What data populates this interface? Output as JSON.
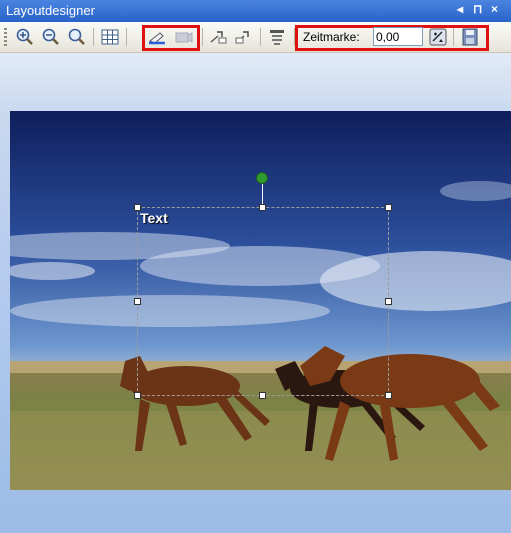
{
  "window": {
    "title": "Layoutdesigner",
    "controls": [
      "◂",
      "⊓",
      "×"
    ]
  },
  "toolbar": {
    "tools": [
      {
        "name": "zoom-in",
        "icon": "zoom-in-icon"
      },
      {
        "name": "zoom-out",
        "icon": "zoom-out-icon"
      },
      {
        "name": "zoom-fit",
        "icon": "zoom-fit-icon"
      },
      {
        "name": "grid",
        "icon": "grid-icon"
      },
      {
        "name": "text",
        "icon": "text-tool-icon"
      },
      {
        "name": "camera",
        "icon": "camera-icon"
      },
      {
        "name": "move-up",
        "icon": "move-up-icon"
      },
      {
        "name": "move-down",
        "icon": "move-down-icon"
      },
      {
        "name": "align",
        "icon": "align-icon"
      },
      {
        "name": "keyframe",
        "icon": "keyframe-icon"
      },
      {
        "name": "save",
        "icon": "save-icon"
      }
    ],
    "zeitmarke_label": "Zeitmarke:",
    "zeitmarke_value": "0,00"
  },
  "canvas": {
    "text_object": "Text"
  },
  "colors": {
    "titlebar": "#2a63c9",
    "highlight": "#e01010",
    "rotate_handle": "#2f9a2f"
  }
}
